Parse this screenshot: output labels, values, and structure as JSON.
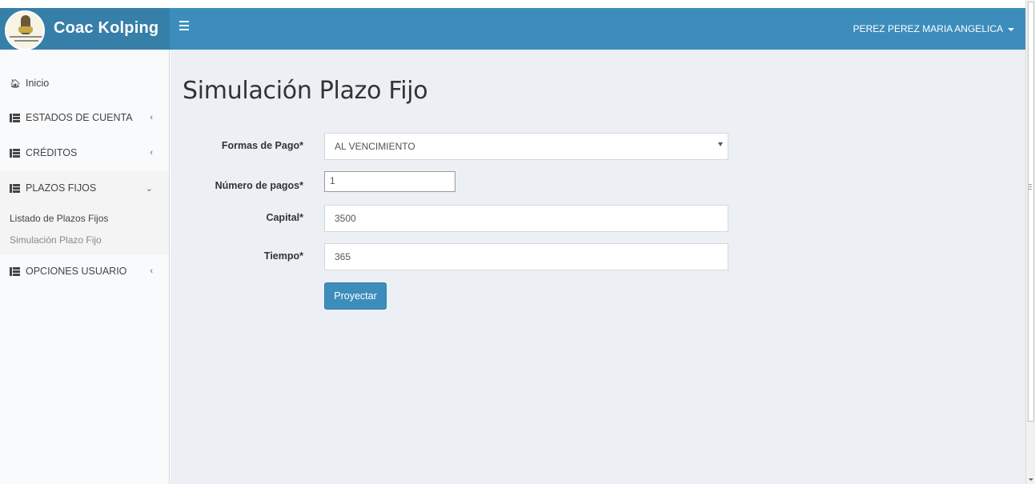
{
  "app": {
    "brand_name": "Coac Kolping",
    "user_name": "PEREZ PEREZ MARIA ANGELICA"
  },
  "sidebar": {
    "home_label": "Inicio",
    "items": [
      {
        "label": "ESTADOS DE CUENTA",
        "chevron": "‹"
      },
      {
        "label": "CRÉDITOS",
        "chevron": "‹"
      },
      {
        "label": "PLAZOS FIJOS",
        "chevron": "⌄"
      },
      {
        "label": "OPCIONES USUARIO",
        "chevron": "‹"
      }
    ],
    "subitems": [
      {
        "label": "Listado de Plazos Fijos"
      },
      {
        "label": "Simulación Plazo Fijo"
      }
    ]
  },
  "main": {
    "title": "Simulación Plazo Fijo",
    "form": {
      "formas_pago_label": "Formas de Pago*",
      "formas_pago_value": "AL VENCIMIENTO",
      "numero_pagos_label": "Número de pagos*",
      "numero_pagos_value": "1",
      "capital_label": "Capital*",
      "capital_value": "3500",
      "tiempo_label": "Tiempo*",
      "tiempo_value": "365",
      "submit_label": "Proyectar"
    }
  },
  "colors": {
    "header": "#3c8dbc",
    "brand": "#367fa9",
    "content_bg": "#ecf0f5",
    "sidebar_bg": "#f9fafc"
  }
}
